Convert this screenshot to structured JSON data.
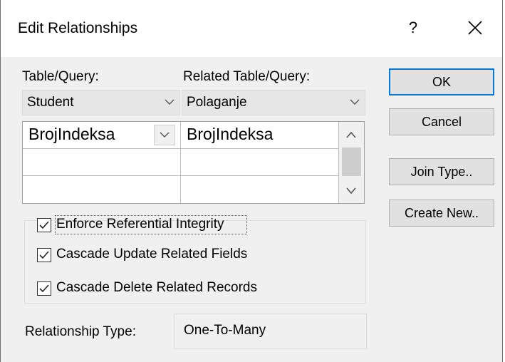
{
  "dialog": {
    "title": "Edit Relationships",
    "help_label": "?",
    "close_label": "✕"
  },
  "left": {
    "table_query_label": "Table/Query:",
    "related_table_query_label": "Related Table/Query:",
    "table_value": "Student",
    "related_table_value": "Polaganje",
    "grid_rows": [
      {
        "field": "BrojIndeksa",
        "related_field": "BrojIndeksa"
      },
      {
        "field": "",
        "related_field": ""
      },
      {
        "field": "",
        "related_field": ""
      }
    ]
  },
  "options": {
    "enforce_integrity": {
      "label": "Enforce Referential Integrity",
      "checked": true
    },
    "cascade_update": {
      "label": "Cascade Update Related Fields",
      "checked": true
    },
    "cascade_delete": {
      "label": "Cascade Delete Related Records",
      "checked": true
    }
  },
  "relationship": {
    "label": "Relationship Type:",
    "value": "One-To-Many"
  },
  "buttons": {
    "ok": "OK",
    "cancel": "Cancel",
    "join_type": "Join Type..",
    "create_new": "Create New.."
  }
}
